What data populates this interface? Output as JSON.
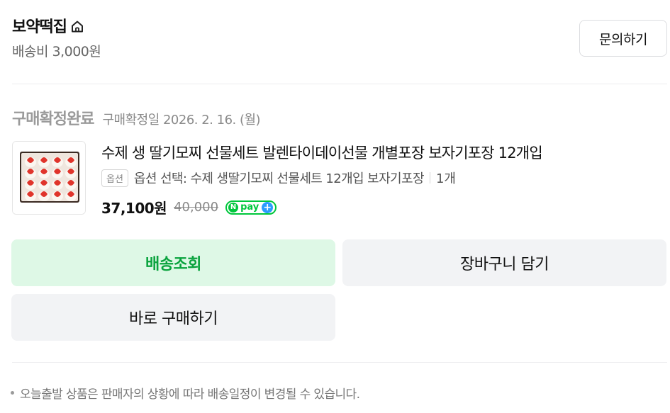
{
  "store": {
    "name": "보약떡집",
    "home_icon": "home-icon",
    "shipping_fee": "배송비 3,000원",
    "inquiry_label": "문의하기"
  },
  "order": {
    "status": "구매확정완료",
    "confirm_date": "구매확정일 2026. 2. 16. (월)"
  },
  "product": {
    "thumbnail_icon": "strawberry-mochi-box-image",
    "title": "수제 생 딸기모찌 선물세트 발렌타이데이선물 개별포장 보자기포장 12개입",
    "option_badge": "옵션",
    "option_text": "옵션 선택: 수제 생딸기모찌 선물세트 12개입 보자기포장",
    "quantity": "1개",
    "sale_price": "37,100원",
    "original_price": "40,000",
    "npay_label": "pay",
    "npay_n": "N",
    "npay_plus": "+"
  },
  "actions": {
    "track_label": "배송조회",
    "cart_label": "장바구니 담기",
    "buy_label": "바로 구매하기"
  },
  "notice": {
    "text": "오늘출발 상품은 판매자의 상황에 따라 배송일정이 변경될 수 있습니다."
  },
  "colors": {
    "accent_green": "#0aa33e",
    "track_bg": "#def8e6",
    "npay_green": "#00c73c",
    "npay_blue": "#2a9bff"
  }
}
